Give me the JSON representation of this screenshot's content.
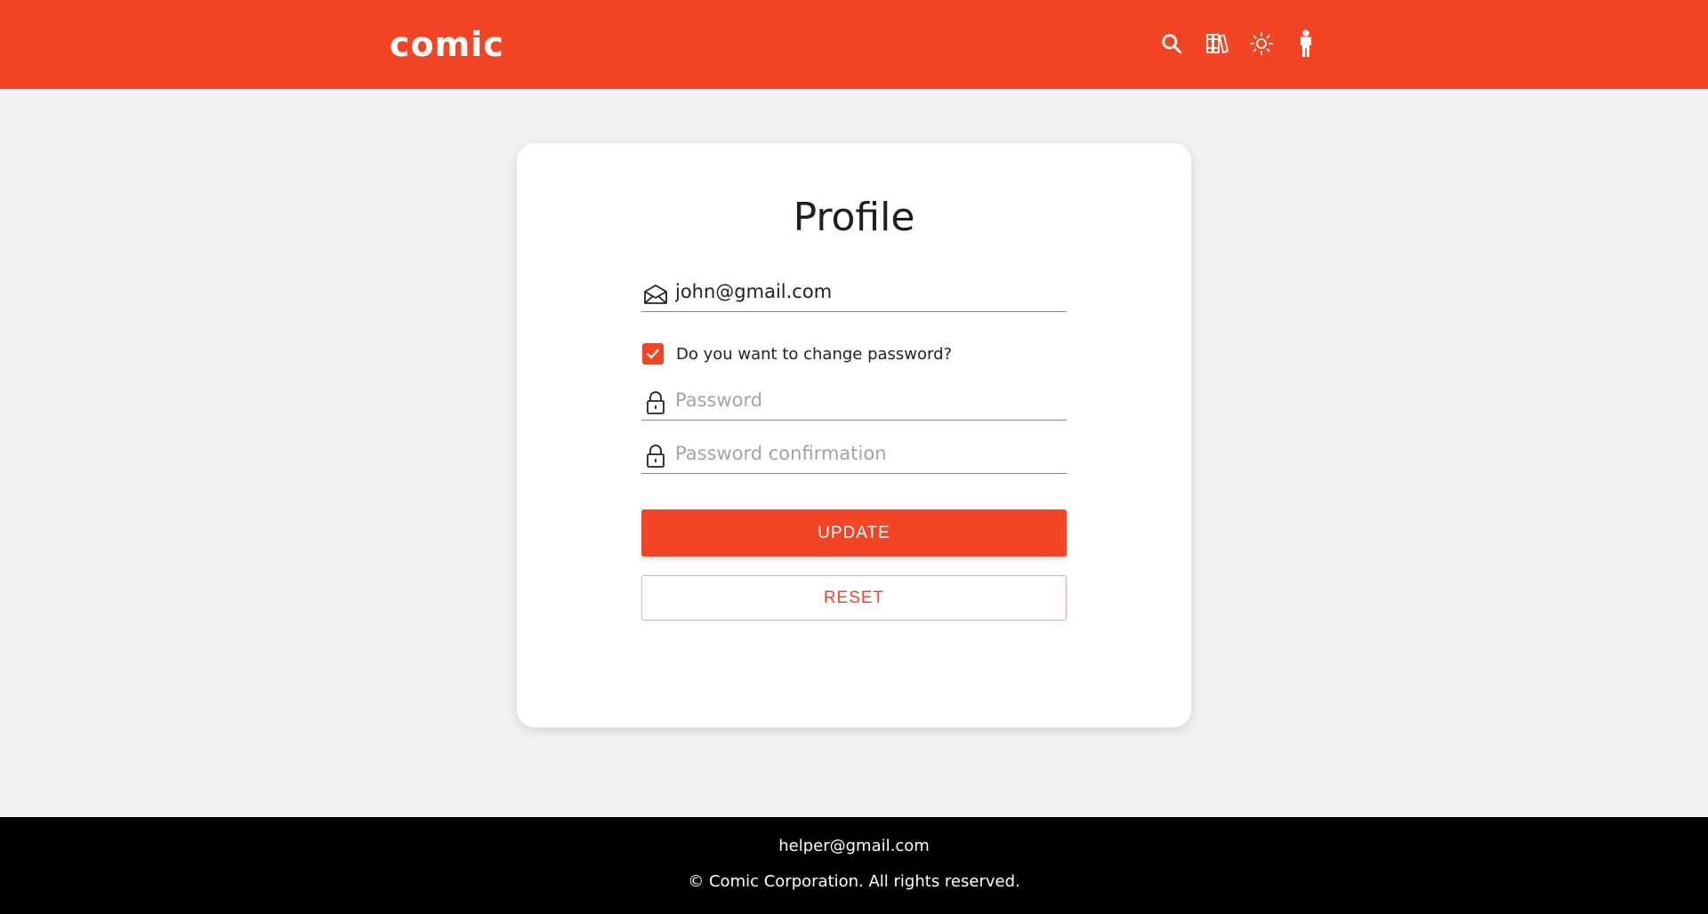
{
  "header": {
    "logo": "comic",
    "icons": [
      "search-icon",
      "library-icon",
      "sun-icon",
      "person-icon"
    ],
    "bg_color": "#f34424"
  },
  "profile": {
    "title": "Profile",
    "email_value": "john@gmail.com",
    "change_password_label": "Do you want to change password?",
    "change_password_checked": true,
    "password_placeholder": "Password",
    "password_confirmation_placeholder": "Password confirmation",
    "update_label": "UPDATE",
    "reset_label": "RESET"
  },
  "footer": {
    "email": "helper@gmail.com",
    "copyright": "© Comic Corporation. All rights reserved."
  },
  "colors": {
    "accent": "#f34424",
    "page_bg": "#f1f2f4",
    "footer_bg": "#000000"
  }
}
